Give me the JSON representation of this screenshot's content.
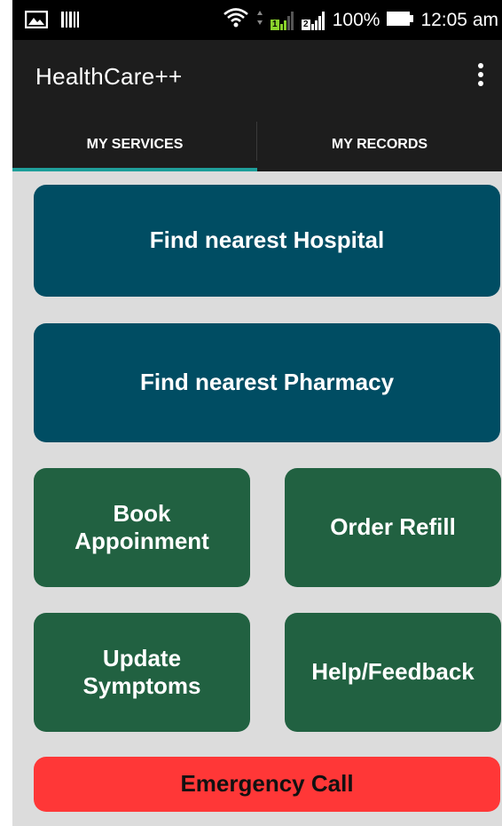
{
  "status_bar": {
    "battery": "100%",
    "time": "12:05 am",
    "sim1": "1",
    "sim2": "2"
  },
  "app_bar": {
    "title": "HealthCare++"
  },
  "tabs": [
    {
      "label": "MY SERVICES",
      "selected": true
    },
    {
      "label": "MY RECORDS",
      "selected": false
    }
  ],
  "buttons": {
    "hospital": "Find nearest Hospital",
    "pharmacy": "Find nearest Pharmacy",
    "book": "Book\nAppoinment",
    "refill": "Order Refill",
    "symptoms": "Update\nSymptoms",
    "help": "Help/Feedback",
    "emergency": "Emergency Call"
  },
  "colors": {
    "primary_button": "#004d63",
    "secondary_button": "#216141",
    "emergency_button": "#ff3737",
    "tab_indicator": "#1e9e9a"
  }
}
